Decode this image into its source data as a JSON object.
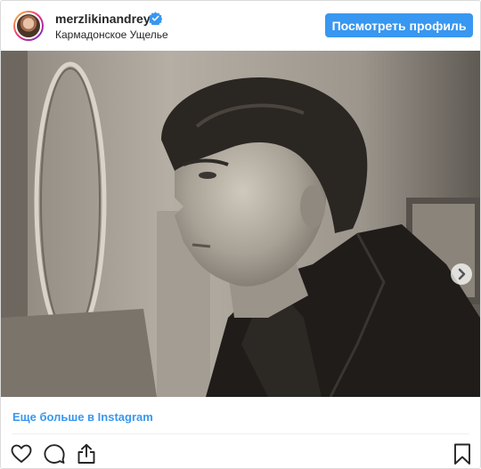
{
  "post": {
    "username": "merzlikinandrey",
    "location": "Кармадонское Ущелье",
    "view_profile_label": "Посмотреть профиль",
    "more_link": "Еще больше в Instagram"
  },
  "icons": {
    "verified": "verified-badge-icon",
    "next": "chevron-right-icon",
    "like": "heart-icon",
    "comment": "comment-icon",
    "share": "share-icon",
    "save": "bookmark-icon"
  },
  "colors": {
    "accent": "#3897f0",
    "text": "#262626",
    "border": "#dbdbdb"
  }
}
